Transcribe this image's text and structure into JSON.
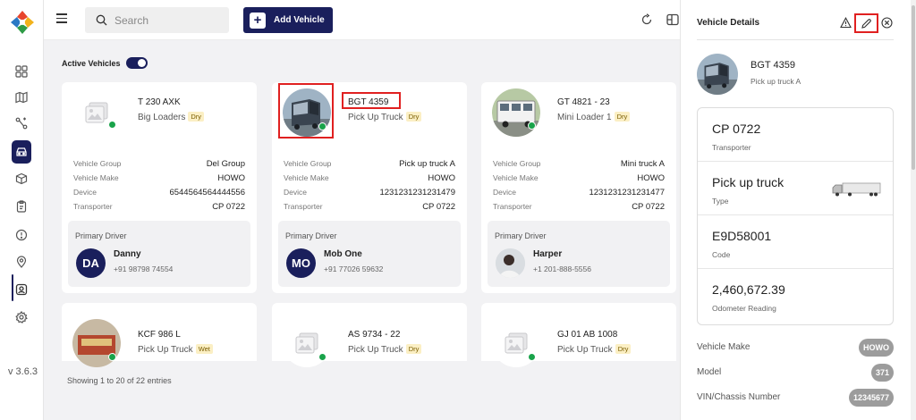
{
  "version": "v 3.6.3",
  "topbar": {
    "search_placeholder": "Search",
    "add_vehicle_label": "Add Vehicle"
  },
  "filters": {
    "active_label": "Active Vehicles",
    "active_on": true
  },
  "vehicles": [
    {
      "plate": "T 230 AXK",
      "type": "Big Loaders",
      "badge": "Dry",
      "vehicle_group_label": "Vehicle Group",
      "vehicle_group": "Del Group",
      "vehicle_make_label": "Vehicle Make",
      "vehicle_make": "HOWO",
      "device_label": "Device",
      "device": "6544564564444556",
      "transporter_label": "Transporter",
      "transporter": "CP 0722",
      "driver_label": "Primary Driver",
      "driver_initials": "DA",
      "driver_name": "Danny",
      "driver_phone": "+91 98798 74554",
      "status": "online"
    },
    {
      "plate": "BGT 4359",
      "type": "Pick Up Truck",
      "badge": "Dry",
      "vehicle_group_label": "Vehicle Group",
      "vehicle_group": "Pick up truck A",
      "vehicle_make_label": "Vehicle Make",
      "vehicle_make": "HOWO",
      "device_label": "Device",
      "device": "1231231231231479",
      "transporter_label": "Transporter",
      "transporter": "CP 0722",
      "driver_label": "Primary Driver",
      "driver_initials": "MO",
      "driver_name": "Mob One",
      "driver_phone": "+91 77026 59632",
      "status": "online"
    },
    {
      "plate": "GT 4821 - 23",
      "type": "Mini Loader 1",
      "badge": "Dry",
      "vehicle_group_label": "Vehicle Group",
      "vehicle_group": "Mini truck A",
      "vehicle_make_label": "Vehicle Make",
      "vehicle_make": "HOWO",
      "device_label": "Device",
      "device": "1231231231231477",
      "transporter_label": "Transporter",
      "transporter": "CP 0722",
      "driver_label": "Primary Driver",
      "driver_initials": "",
      "driver_name": "Harper",
      "driver_phone": "+1 201-888-5556",
      "status": "online"
    },
    {
      "plate": "KCF 986 L",
      "type": "Pick Up Truck",
      "badge": "Wet",
      "status": "online"
    },
    {
      "plate": "AS 9734 - 22",
      "type": "Pick Up Truck",
      "badge": "Dry",
      "status": "online"
    },
    {
      "plate": "GJ 01 AB 1008",
      "type": "Pick Up Truck",
      "badge": "Dry",
      "status": "online"
    }
  ],
  "pagination": {
    "text": "Showing 1 to 20 of 22 entries"
  },
  "panel": {
    "title": "Vehicle Details",
    "plate": "BGT 4359",
    "subtitle": "Pick up truck A",
    "rows": [
      {
        "value": "CP 0722",
        "label": "Transporter"
      },
      {
        "value": "Pick up truck",
        "label": "Type"
      },
      {
        "value": "E9D58001",
        "label": "Code"
      },
      {
        "value": "2,460,672.39",
        "label": "Odometer Reading"
      }
    ],
    "attributes": [
      {
        "label": "Vehicle Make",
        "value": "HOWO"
      },
      {
        "label": "Model",
        "value": "371"
      },
      {
        "label": "VIN/Chassis Number",
        "value": "12345677"
      }
    ]
  },
  "colors": {
    "primary": "#1a1f5c",
    "online": "#19a34a",
    "highlight": "#e02020",
    "badge_bg": "#fbefc4"
  }
}
